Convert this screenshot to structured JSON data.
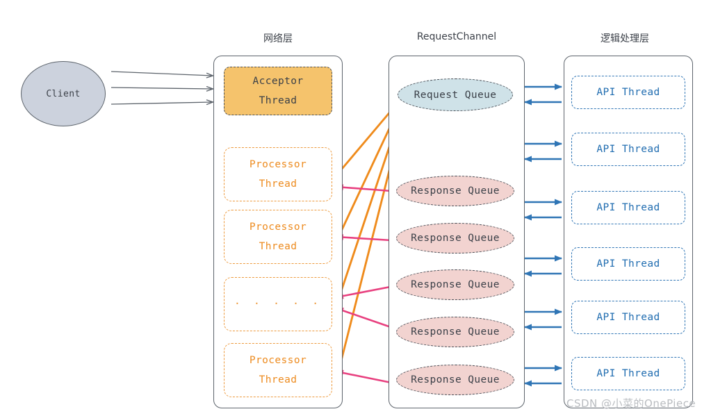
{
  "diagram": {
    "title_bar": null,
    "columns": [
      {
        "id": "network",
        "header": "网络层"
      },
      {
        "id": "request_channel",
        "header": "RequestChannel"
      },
      {
        "id": "logic",
        "header": "逻辑处理层"
      }
    ],
    "client": {
      "label": "Client"
    },
    "network_layer": {
      "acceptor": {
        "line1": "Acceptor",
        "line2": "Thread"
      },
      "processors": [
        {
          "line1": "Processor",
          "line2": "Thread"
        },
        {
          "line1": "Processor",
          "line2": "Thread"
        },
        {
          "line1": "· · · · ·",
          "line2": ""
        },
        {
          "line1": "Processor",
          "line2": "Thread"
        }
      ]
    },
    "request_channel": {
      "request_queue": {
        "label": "Request Queue"
      },
      "response_queues": [
        {
          "label": "Response Queue"
        },
        {
          "label": "Response Queue"
        },
        {
          "label": "Response Queue"
        },
        {
          "label": "Response Queue"
        },
        {
          "label": "Response Queue"
        }
      ]
    },
    "logic_layer": {
      "api_threads": [
        {
          "label": "API Thread"
        },
        {
          "label": "API Thread"
        },
        {
          "label": "API Thread"
        },
        {
          "label": "API Thread"
        },
        {
          "label": "API Thread"
        },
        {
          "label": "API Thread"
        }
      ]
    },
    "watermark": {
      "text": "CSDN @小菜的OnePiece"
    },
    "colors": {
      "acceptor_fill": "#f5c36c",
      "processor_stroke": "#ed9a3d",
      "processor_text": "#ed8b1f",
      "api_stroke": "#2f75b5",
      "api_text": "#1f6cb0",
      "request_queue_fill": "#cfe2e8",
      "response_queue_fill": "#f2d3d0",
      "client_fill": "#ccd2dd",
      "container_stroke": "#5c636b",
      "orange_arrow": "#ef8b1c",
      "pink_arrow": "#e8407f",
      "blue_arrow": "#2f75b5",
      "gray_arrow": "#5c636b",
      "header_text": "#3b4048",
      "watermark_text": "#b9bcc0"
    }
  }
}
